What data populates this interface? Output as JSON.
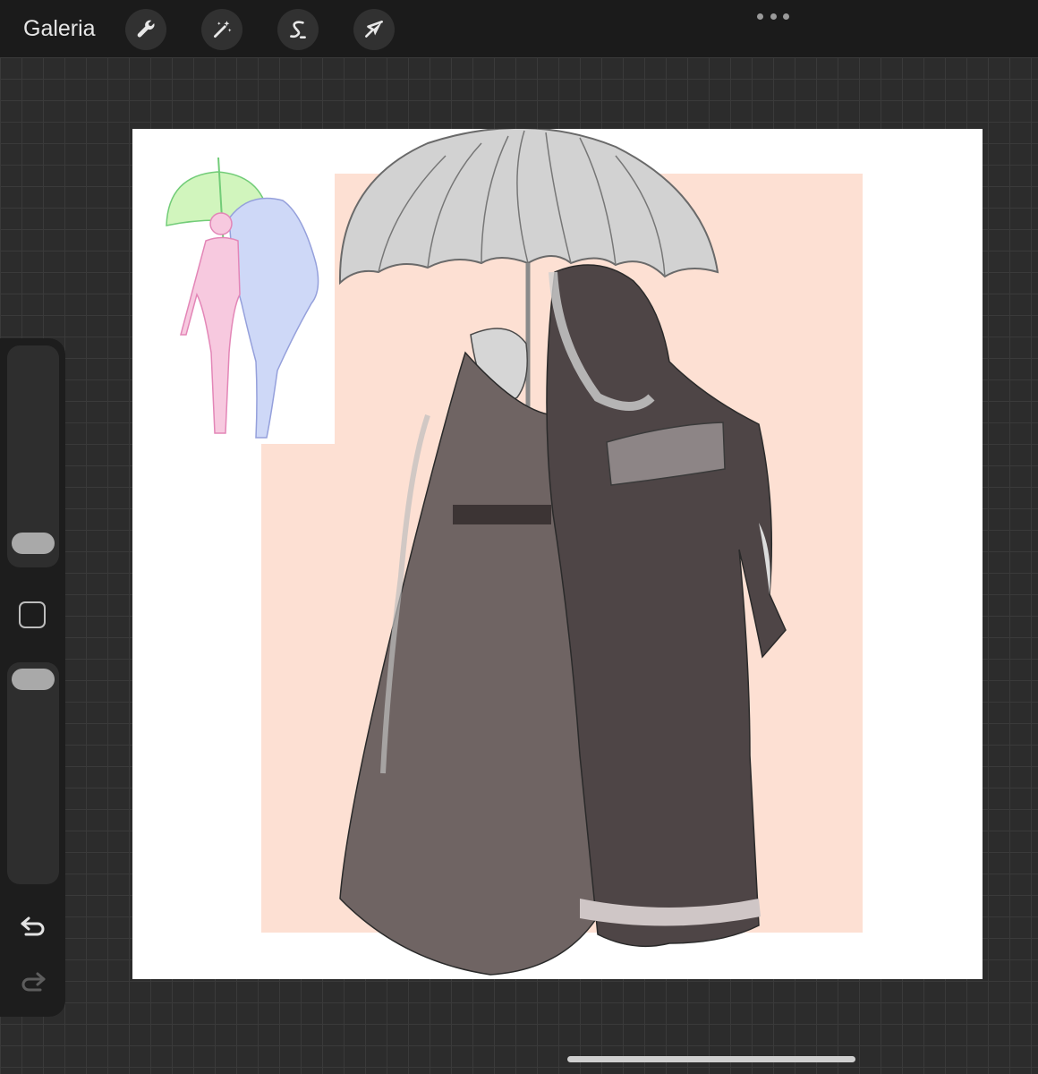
{
  "topbar": {
    "gallery_label": "Galeria",
    "tools": [
      {
        "name": "actions",
        "icon": "wrench-icon"
      },
      {
        "name": "adjustments",
        "icon": "magic-wand-icon"
      },
      {
        "name": "selection",
        "icon": "selection-s-icon"
      },
      {
        "name": "transform",
        "icon": "arrow-cursor-icon"
      }
    ],
    "more_icon": "more-dots-icon"
  },
  "sidebar": {
    "size_slider_icon": "slider-thumb",
    "modify_icon": "square-modify-icon",
    "undo_icon": "undo-arrow-icon",
    "redo_icon": "redo-arrow-icon"
  },
  "canvas": {
    "background_color": "#ffffff",
    "block_color": "#fde0d3",
    "artwork": "digital-drawing"
  },
  "colors": {
    "topbar": "#1b1b1b",
    "workspace": "#2c2c2c",
    "sidebar": "#1d1d1d",
    "thumb": "#a9a9a9"
  }
}
